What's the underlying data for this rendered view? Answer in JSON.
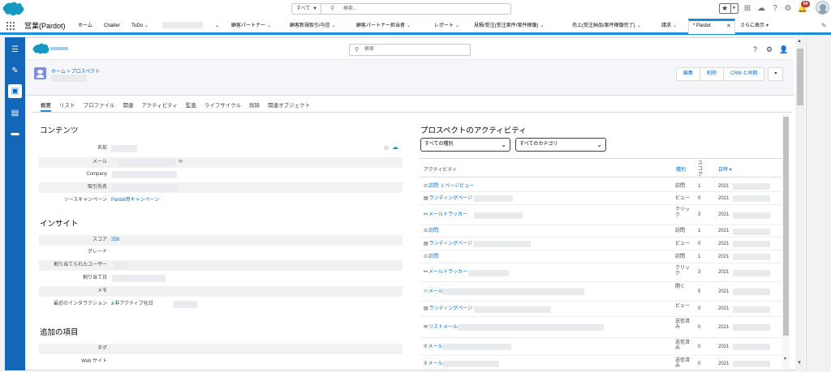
{
  "global": {
    "search_scope": "すべて",
    "search_placeholder": "検索...",
    "notifications_count": "54"
  },
  "nav": {
    "app_name": "営業(Pardot)",
    "items": [
      "ホーム",
      "Chatter",
      "ToDo",
      "顧客パートナー",
      "顧客新規取引/与信",
      "顧客パートナー担当者",
      "レポート",
      "見積/受注(受注案件/案件稼働)",
      "売上(受注納品/案件稼働完了)",
      "請求"
    ],
    "active_tab": "* Pardot",
    "more": "さらに表示"
  },
  "pardot": {
    "search_placeholder": "検索",
    "breadcrumb": "ホーム > プロスペクト",
    "buttons": [
      "編集",
      "削除",
      "CRM と同期"
    ]
  },
  "tabs": [
    "概要",
    "リスト",
    "プロファイル",
    "関連",
    "アクティビティ",
    "監査",
    "ライフサイクル",
    "削除",
    "関連オブジェクト"
  ],
  "contents": {
    "title": "コンテンツ",
    "fields": [
      {
        "label": "名前",
        "value": ""
      },
      {
        "label": "メール",
        "value": ""
      },
      {
        "label": "Company",
        "value": ""
      },
      {
        "label": "取引先名",
        "value": ""
      },
      {
        "label": "ソースキャンペーン",
        "value": "Pardot用キャンペーン"
      }
    ]
  },
  "insight": {
    "title": "インサイト",
    "fields": [
      {
        "label": "スコア",
        "value": "258"
      },
      {
        "label": "グレード",
        "value": ""
      },
      {
        "label": "割り当てられたユーザー",
        "value": ""
      },
      {
        "label": "割り当て日",
        "value": ""
      },
      {
        "label": "メモ",
        "value": ""
      },
      {
        "label": "最近のインタラクション",
        "value": "非アクティブ化日"
      }
    ]
  },
  "additional": {
    "title": "追加の項目",
    "fields": [
      {
        "label": "タグ",
        "value": ""
      },
      {
        "label": "Web サイト",
        "value": ""
      }
    ]
  },
  "activity": {
    "title": "プロスペクトのアクティビティ",
    "filter_type": "すべての種別",
    "filter_category": "すべてのカテゴリ",
    "headers": {
      "activity": "アクティビティ",
      "type": "種別",
      "score": "スコア",
      "date": "日時 ▾"
    },
    "rows": [
      {
        "icon": "clock",
        "label": "訪問: 1 ページビュー",
        "type": "訪問",
        "score": "1",
        "date": "2021"
      },
      {
        "icon": "page",
        "label": "ランディングページ",
        "type": "ビュー",
        "score": "0",
        "date": "2021"
      },
      {
        "icon": "link",
        "label": "メールトラッカー:",
        "type": "クリック",
        "score": "3",
        "date": "2021"
      },
      {
        "icon": "clock",
        "label": "訪問:",
        "type": "訪問",
        "score": "1",
        "date": "2021"
      },
      {
        "icon": "page",
        "label": "ランディングページ",
        "type": "ビュー",
        "score": "0",
        "date": "2021"
      },
      {
        "icon": "clock",
        "label": "訪問:",
        "type": "訪問",
        "score": "1",
        "date": "2021"
      },
      {
        "icon": "link",
        "label": "メールトラッカー",
        "type": "クリック",
        "score": "3",
        "date": "2021"
      },
      {
        "icon": "mail",
        "label": "メール",
        "type": "開く",
        "score": "5",
        "date": "2021"
      },
      {
        "icon": "page",
        "label": "ランディングページ",
        "type": "ビュー",
        "score": "0",
        "date": "2021"
      },
      {
        "icon": "mailbox",
        "label": "リストメール",
        "type": "送信済み",
        "score": "0",
        "date": "2021"
      },
      {
        "icon": "tree",
        "label": "メール",
        "type": "送信済み",
        "score": "0",
        "date": "2021"
      },
      {
        "icon": "tree",
        "label": "メール",
        "type": "送信済み",
        "score": "0",
        "date": "2021"
      }
    ]
  }
}
